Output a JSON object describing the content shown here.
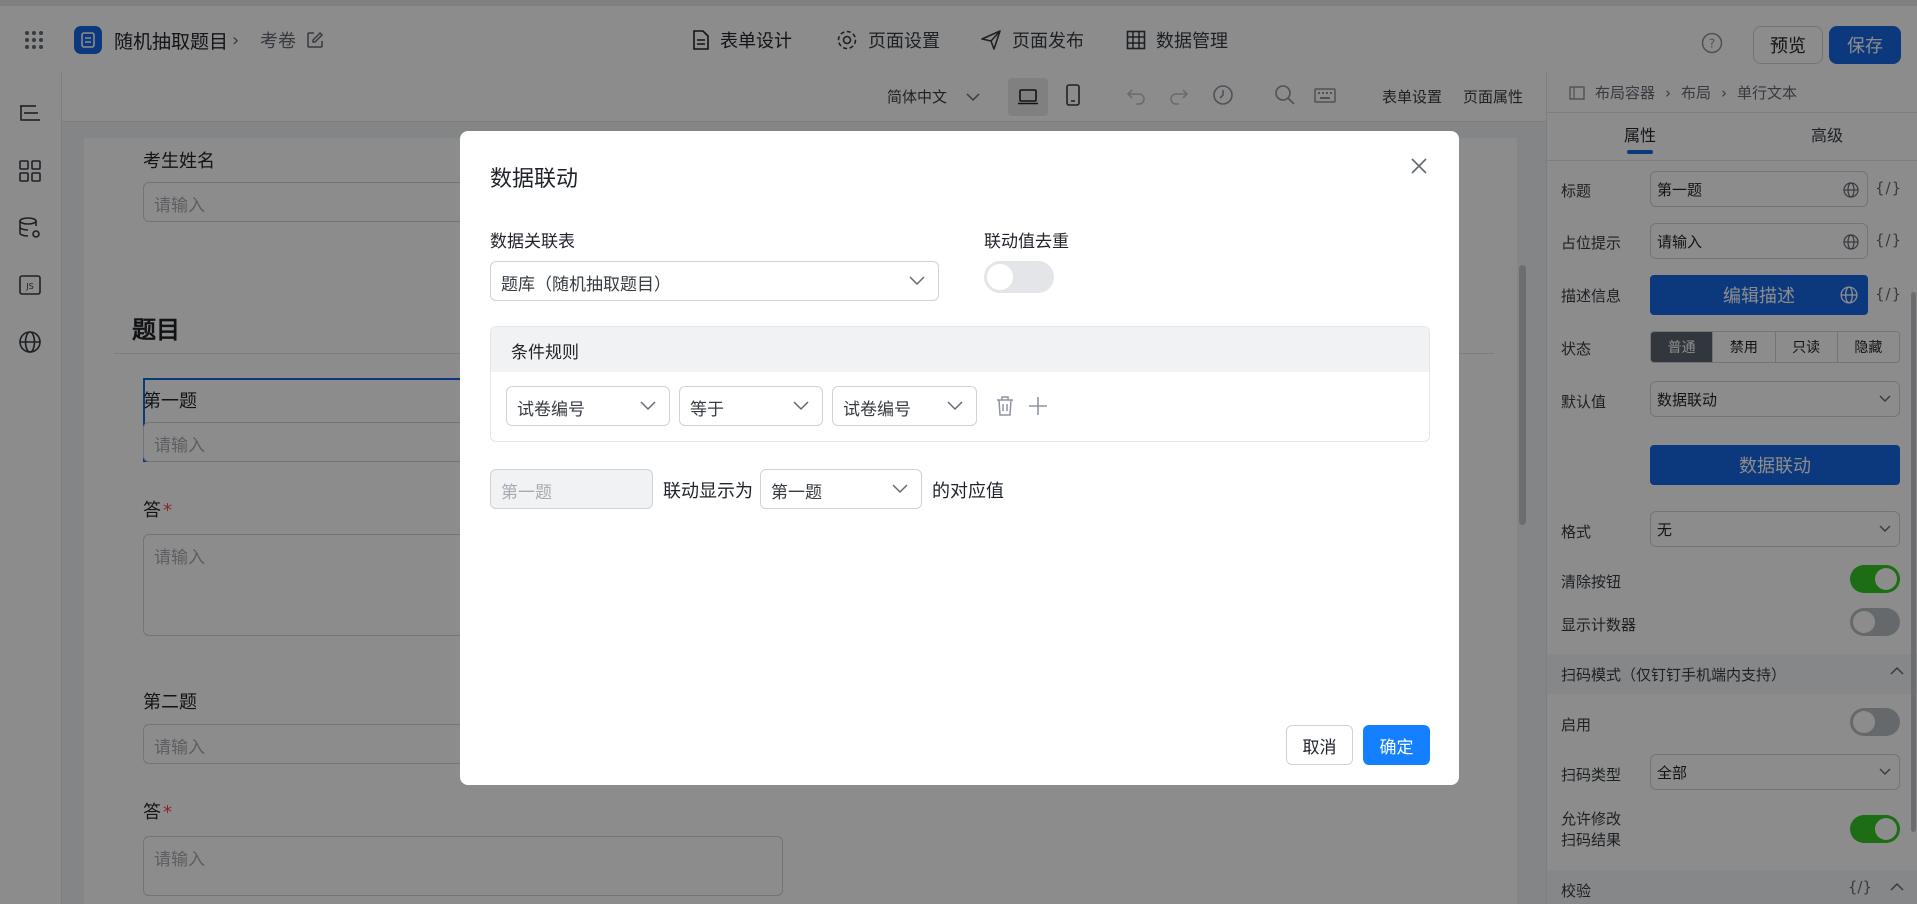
{
  "app": {
    "name": "随机抽取题目",
    "page": "考卷"
  },
  "nav": {
    "tabs": [
      "表单设计",
      "页面设置",
      "页面发布",
      "数据管理"
    ]
  },
  "header": {
    "preview": "预览",
    "save": "保存"
  },
  "toolbar": {
    "language": "简体中文",
    "form_settings": "表单设置",
    "page_props": "页面属性"
  },
  "form": {
    "field1_label": "考生姓名",
    "placeholder": "请输入",
    "section": "题目",
    "q1": "第一题",
    "answer": "答",
    "q2": "第二题",
    "required": "*"
  },
  "right_panel": {
    "breadcrumb": [
      "布局容器",
      "布局",
      "单行文本"
    ],
    "tabs": [
      "属性",
      "高级"
    ],
    "title_label": "标题",
    "title_value": "第一题",
    "placeholder_label": "占位提示",
    "placeholder_value": "请输入",
    "desc_label": "描述信息",
    "desc_button": "编辑描述",
    "state_label": "状态",
    "states": [
      "普通",
      "禁用",
      "只读",
      "隐藏"
    ],
    "default_label": "默认值",
    "default_value": "数据联动",
    "linkage_button": "数据联动",
    "format_label": "格式",
    "format_value": "无",
    "clear_label": "清除按钮",
    "counter_label": "显示计数器",
    "scan_section": "扫码模式（仅钉钉手机端内支持）",
    "enable_label": "启用",
    "scan_type_label": "扫码类型",
    "scan_type_value": "全部",
    "allow_edit_label1": "允许修改",
    "allow_edit_label2": "扫码结果",
    "validate_section": "校验",
    "fx": "{/}"
  },
  "modal": {
    "title": "数据联动",
    "related_table_label": "数据关联表",
    "related_table_value": "题库（随机抽取题目）",
    "dedupe_label": "联动值去重",
    "cond_title": "条件规则",
    "cond_field": "试卷编号",
    "cond_op": "等于",
    "cond_value": "试卷编号",
    "target_field": "第一题",
    "display_as": "联动显示为",
    "display_field": "第一题",
    "suffix": "的对应值",
    "cancel": "取消",
    "confirm": "确定"
  }
}
